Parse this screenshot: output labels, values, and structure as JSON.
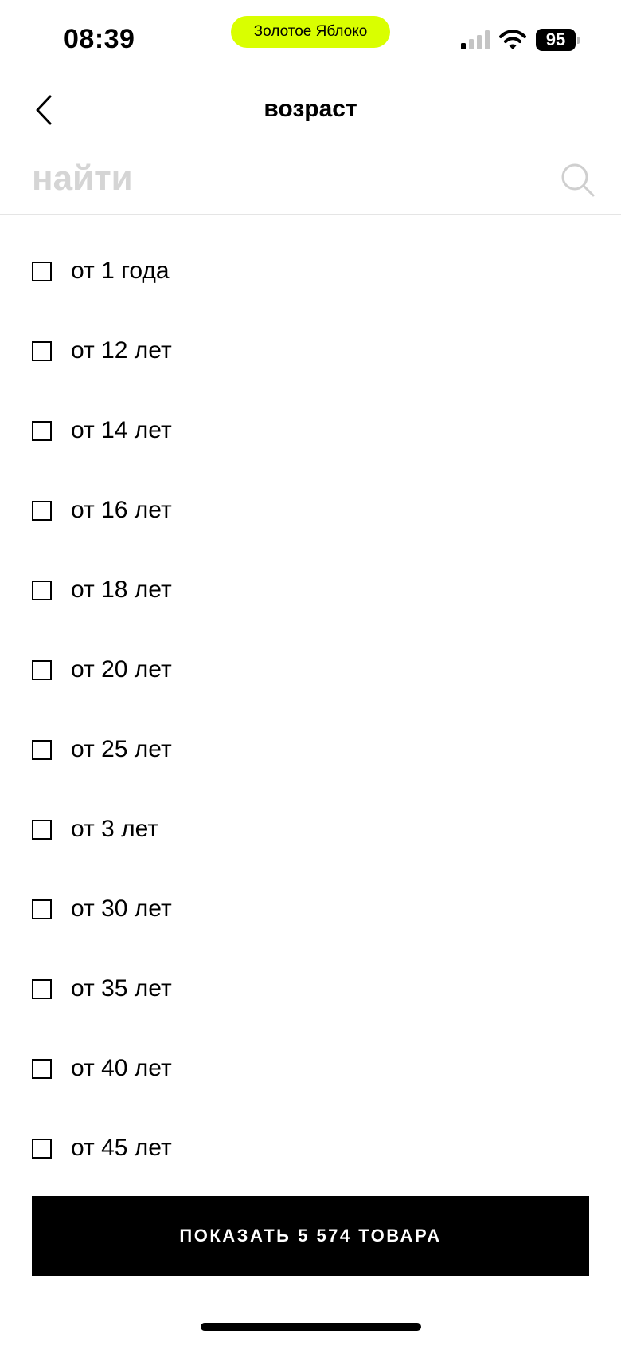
{
  "status_bar": {
    "time": "08:39",
    "app_name": "Золотое Яблоко",
    "app_pill_color": "#d9ff00",
    "battery_level": "95",
    "signal_bars_active": 1,
    "signal_bars_total": 4
  },
  "header": {
    "title": "возраст",
    "back_icon": "chevron-left-icon"
  },
  "search": {
    "placeholder": "найти",
    "value": "",
    "icon": "search-icon"
  },
  "age_options": [
    {
      "label": "от 1 года",
      "checked": false
    },
    {
      "label": "от 12 лет",
      "checked": false
    },
    {
      "label": "от 14 лет",
      "checked": false
    },
    {
      "label": "от 16 лет",
      "checked": false
    },
    {
      "label": "от 18 лет",
      "checked": false
    },
    {
      "label": "от 20 лет",
      "checked": false
    },
    {
      "label": "от 25 лет",
      "checked": false
    },
    {
      "label": "от 3 лет",
      "checked": false
    },
    {
      "label": "от 30 лет",
      "checked": false
    },
    {
      "label": "от 35 лет",
      "checked": false
    },
    {
      "label": "от 40 лет",
      "checked": false
    },
    {
      "label": "от 45 лет",
      "checked": false
    }
  ],
  "footer": {
    "show_button_label": "ПОКАЗАТЬ 5 574 ТОВАРА"
  }
}
